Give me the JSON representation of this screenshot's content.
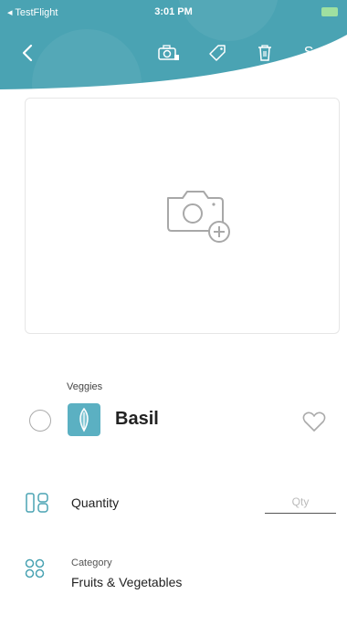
{
  "status_bar": {
    "back_app": "◂ TestFlight",
    "time": "3:01 PM"
  },
  "toolbar": {
    "save_label": "Save"
  },
  "item": {
    "category_label": "Veggies",
    "name": "Basil"
  },
  "quantity": {
    "label": "Quantity",
    "placeholder": "Qty"
  },
  "category": {
    "label": "Category",
    "value": "Fruits & Vegetables"
  },
  "colors": {
    "accent": "#4aa3b3",
    "icon_teal": "#5bb0c2"
  }
}
